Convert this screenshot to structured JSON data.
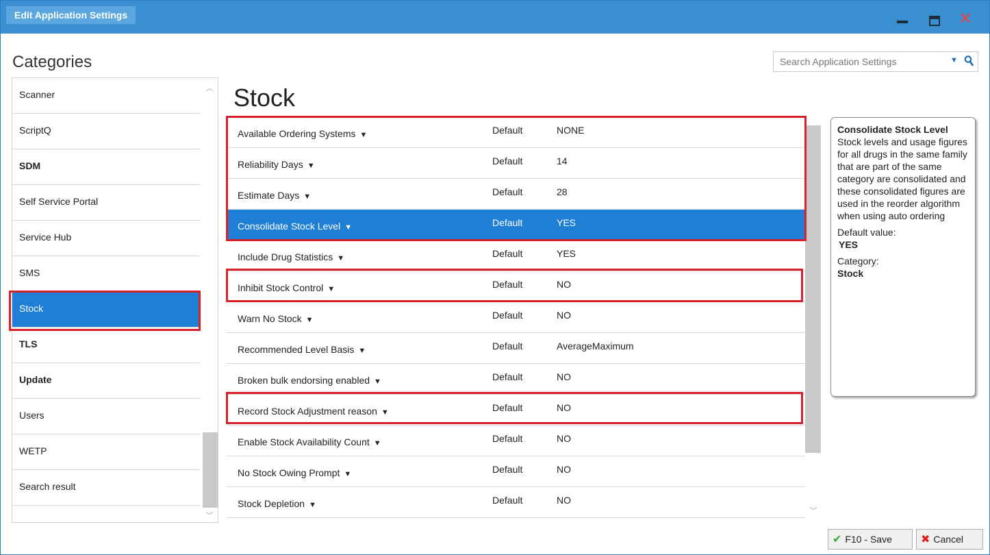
{
  "window": {
    "title": "Edit Application Settings"
  },
  "categories": {
    "heading": "Categories",
    "items": [
      {
        "label": "Scanner",
        "bold": false
      },
      {
        "label": "ScriptQ",
        "bold": false
      },
      {
        "label": "SDM",
        "bold": true
      },
      {
        "label": "Self Service Portal",
        "bold": false
      },
      {
        "label": "Service Hub",
        "bold": false
      },
      {
        "label": "SMS",
        "bold": false
      },
      {
        "label": "Stock",
        "bold": false
      },
      {
        "label": "TLS",
        "bold": true
      },
      {
        "label": "Update",
        "bold": true
      },
      {
        "label": "Users",
        "bold": false
      },
      {
        "label": "WETP",
        "bold": false
      },
      {
        "label": "Search result",
        "bold": false
      }
    ],
    "selected": "Stock"
  },
  "search": {
    "placeholder": "Search Application Settings"
  },
  "main": {
    "heading": "Stock",
    "settings": [
      {
        "name": "Available Ordering Systems",
        "source": "Default",
        "value": "NONE"
      },
      {
        "name": "Reliability Days",
        "source": "Default",
        "value": "14"
      },
      {
        "name": "Estimate Days",
        "source": "Default",
        "value": "28"
      },
      {
        "name": "Consolidate Stock Level",
        "source": "Default",
        "value": "YES"
      },
      {
        "name": "Include Drug Statistics",
        "source": "Default",
        "value": "YES"
      },
      {
        "name": "Inhibit Stock Control",
        "source": "Default",
        "value": "NO"
      },
      {
        "name": "Warn No Stock",
        "source": "Default",
        "value": "NO"
      },
      {
        "name": "Recommended Level Basis",
        "source": "Default",
        "value": "AverageMaximum"
      },
      {
        "name": "Broken bulk endorsing enabled",
        "source": "Default",
        "value": "NO"
      },
      {
        "name": "Record Stock Adjustment reason",
        "source": "Default",
        "value": "NO"
      },
      {
        "name": "Enable Stock Availability Count",
        "source": "Default",
        "value": "NO"
      },
      {
        "name": "No Stock Owing Prompt",
        "source": "Default",
        "value": "NO"
      },
      {
        "name": "Stock Depletion",
        "source": "Default",
        "value": "NO"
      }
    ],
    "selected_setting": "Consolidate Stock Level"
  },
  "info": {
    "title": "Consolidate Stock Level",
    "description": "Stock levels and usage figures for all drugs in the same family that are part of the same category are consolidated and these consolidated figures are used in the reorder algorithm when using auto ordering",
    "default_label": "Default value:",
    "default_value": "YES",
    "category_label": "Category:",
    "category_value": "Stock"
  },
  "buttons": {
    "save": "F10 - Save",
    "cancel": "Cancel"
  },
  "colors": {
    "titlebar": "#3a8fd1",
    "selection": "#1e7fd4",
    "highlight": "#d6202a"
  }
}
